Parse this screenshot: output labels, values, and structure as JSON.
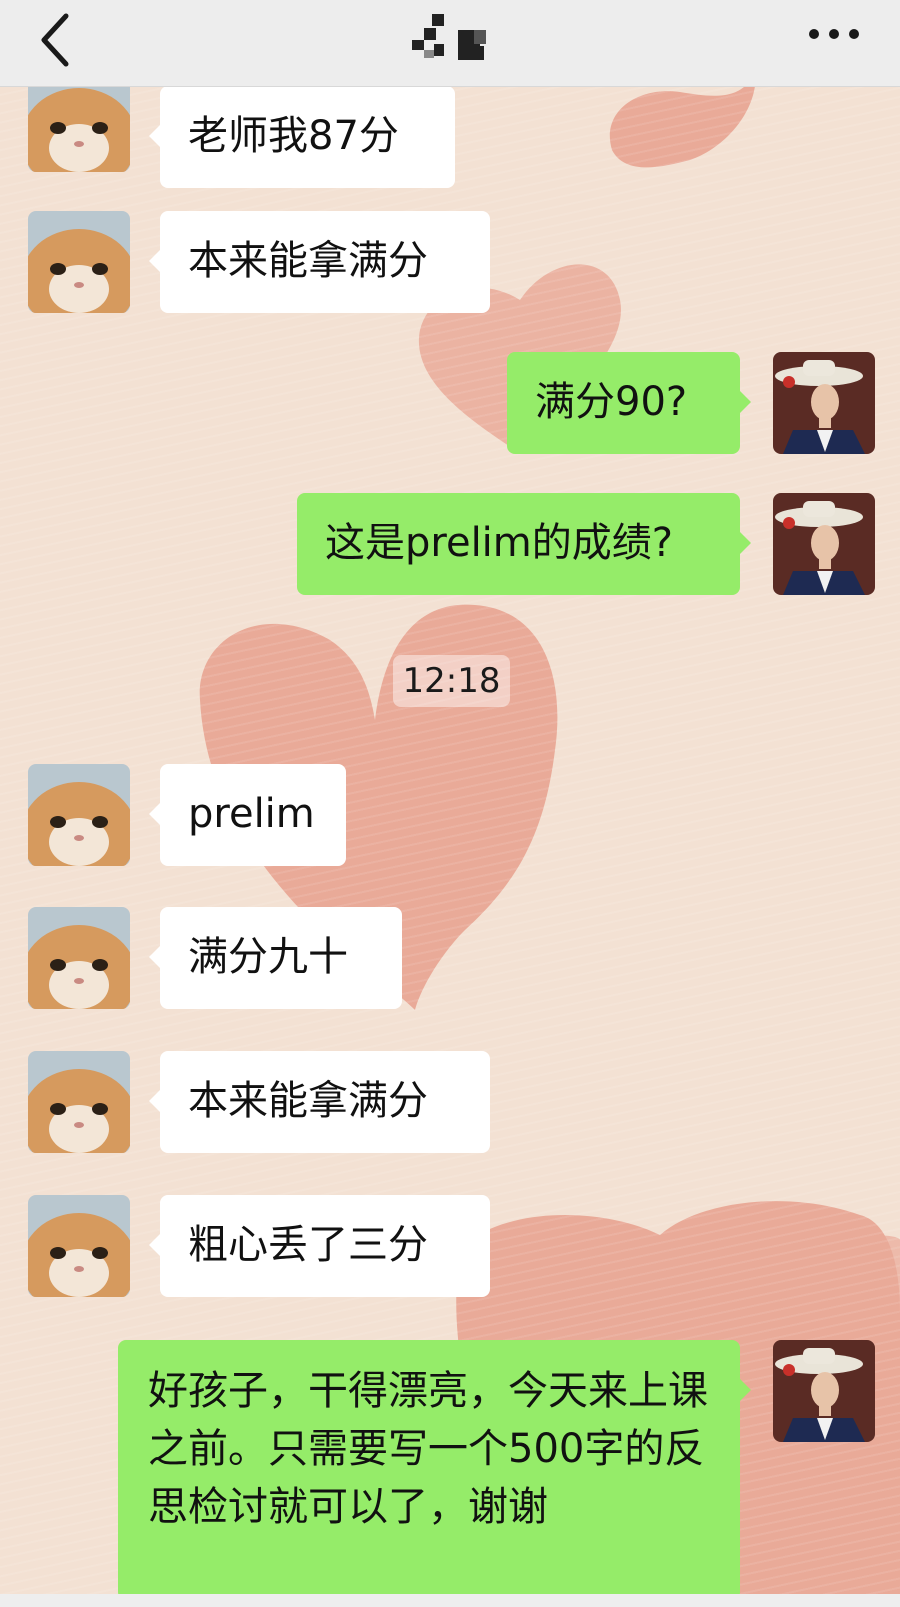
{
  "header": {
    "title": "",
    "back_icon": "chevron-left-icon",
    "more_icon": "ellipsis-icon"
  },
  "colors": {
    "header_bg": "#ededed",
    "wallpaper_bg": "#f3e1d3",
    "heart": "#e59a88",
    "sent_bubble": "#95ec69",
    "received_bubble": "#ffffff"
  },
  "messages": [
    {
      "side": "received",
      "text": "老师我87分"
    },
    {
      "side": "received",
      "text": "本来能拿满分"
    },
    {
      "side": "sent",
      "text": "满分90?"
    },
    {
      "side": "sent",
      "text": "这是prelim的成绩?"
    },
    {
      "side": "time",
      "text": "12:18"
    },
    {
      "side": "received",
      "text": "prelim"
    },
    {
      "side": "received",
      "text": "满分九十"
    },
    {
      "side": "received",
      "text": "本来能拿满分"
    },
    {
      "side": "received",
      "text": "粗心丢了三分"
    },
    {
      "side": "sent",
      "text": "好孩子，干得漂亮，今天来上课之前。只需要写一个500字的反思检讨就可以了，谢谢"
    }
  ]
}
